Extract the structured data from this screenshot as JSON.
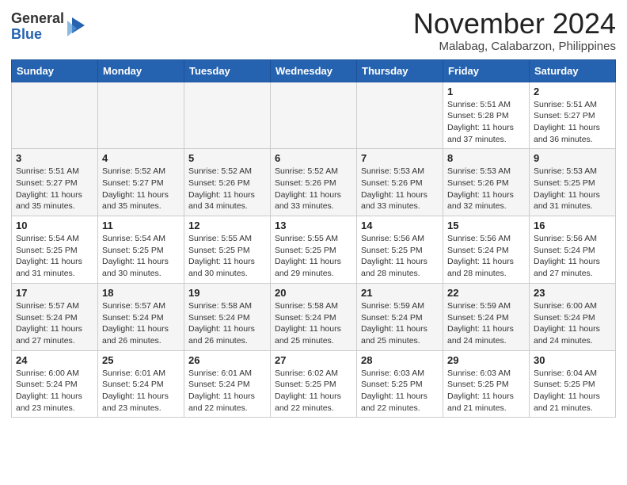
{
  "logo": {
    "general": "General",
    "blue": "Blue"
  },
  "title": "November 2024",
  "location": "Malabag, Calabarzon, Philippines",
  "weekdays": [
    "Sunday",
    "Monday",
    "Tuesday",
    "Wednesday",
    "Thursday",
    "Friday",
    "Saturday"
  ],
  "weeks": [
    [
      {
        "day": "",
        "info": ""
      },
      {
        "day": "",
        "info": ""
      },
      {
        "day": "",
        "info": ""
      },
      {
        "day": "",
        "info": ""
      },
      {
        "day": "",
        "info": ""
      },
      {
        "day": "1",
        "info": "Sunrise: 5:51 AM\nSunset: 5:28 PM\nDaylight: 11 hours\nand 37 minutes."
      },
      {
        "day": "2",
        "info": "Sunrise: 5:51 AM\nSunset: 5:27 PM\nDaylight: 11 hours\nand 36 minutes."
      }
    ],
    [
      {
        "day": "3",
        "info": "Sunrise: 5:51 AM\nSunset: 5:27 PM\nDaylight: 11 hours\nand 35 minutes."
      },
      {
        "day": "4",
        "info": "Sunrise: 5:52 AM\nSunset: 5:27 PM\nDaylight: 11 hours\nand 35 minutes."
      },
      {
        "day": "5",
        "info": "Sunrise: 5:52 AM\nSunset: 5:26 PM\nDaylight: 11 hours\nand 34 minutes."
      },
      {
        "day": "6",
        "info": "Sunrise: 5:52 AM\nSunset: 5:26 PM\nDaylight: 11 hours\nand 33 minutes."
      },
      {
        "day": "7",
        "info": "Sunrise: 5:53 AM\nSunset: 5:26 PM\nDaylight: 11 hours\nand 33 minutes."
      },
      {
        "day": "8",
        "info": "Sunrise: 5:53 AM\nSunset: 5:26 PM\nDaylight: 11 hours\nand 32 minutes."
      },
      {
        "day": "9",
        "info": "Sunrise: 5:53 AM\nSunset: 5:25 PM\nDaylight: 11 hours\nand 31 minutes."
      }
    ],
    [
      {
        "day": "10",
        "info": "Sunrise: 5:54 AM\nSunset: 5:25 PM\nDaylight: 11 hours\nand 31 minutes."
      },
      {
        "day": "11",
        "info": "Sunrise: 5:54 AM\nSunset: 5:25 PM\nDaylight: 11 hours\nand 30 minutes."
      },
      {
        "day": "12",
        "info": "Sunrise: 5:55 AM\nSunset: 5:25 PM\nDaylight: 11 hours\nand 30 minutes."
      },
      {
        "day": "13",
        "info": "Sunrise: 5:55 AM\nSunset: 5:25 PM\nDaylight: 11 hours\nand 29 minutes."
      },
      {
        "day": "14",
        "info": "Sunrise: 5:56 AM\nSunset: 5:25 PM\nDaylight: 11 hours\nand 28 minutes."
      },
      {
        "day": "15",
        "info": "Sunrise: 5:56 AM\nSunset: 5:24 PM\nDaylight: 11 hours\nand 28 minutes."
      },
      {
        "day": "16",
        "info": "Sunrise: 5:56 AM\nSunset: 5:24 PM\nDaylight: 11 hours\nand 27 minutes."
      }
    ],
    [
      {
        "day": "17",
        "info": "Sunrise: 5:57 AM\nSunset: 5:24 PM\nDaylight: 11 hours\nand 27 minutes."
      },
      {
        "day": "18",
        "info": "Sunrise: 5:57 AM\nSunset: 5:24 PM\nDaylight: 11 hours\nand 26 minutes."
      },
      {
        "day": "19",
        "info": "Sunrise: 5:58 AM\nSunset: 5:24 PM\nDaylight: 11 hours\nand 26 minutes."
      },
      {
        "day": "20",
        "info": "Sunrise: 5:58 AM\nSunset: 5:24 PM\nDaylight: 11 hours\nand 25 minutes."
      },
      {
        "day": "21",
        "info": "Sunrise: 5:59 AM\nSunset: 5:24 PM\nDaylight: 11 hours\nand 25 minutes."
      },
      {
        "day": "22",
        "info": "Sunrise: 5:59 AM\nSunset: 5:24 PM\nDaylight: 11 hours\nand 24 minutes."
      },
      {
        "day": "23",
        "info": "Sunrise: 6:00 AM\nSunset: 5:24 PM\nDaylight: 11 hours\nand 24 minutes."
      }
    ],
    [
      {
        "day": "24",
        "info": "Sunrise: 6:00 AM\nSunset: 5:24 PM\nDaylight: 11 hours\nand 23 minutes."
      },
      {
        "day": "25",
        "info": "Sunrise: 6:01 AM\nSunset: 5:24 PM\nDaylight: 11 hours\nand 23 minutes."
      },
      {
        "day": "26",
        "info": "Sunrise: 6:01 AM\nSunset: 5:24 PM\nDaylight: 11 hours\nand 22 minutes."
      },
      {
        "day": "27",
        "info": "Sunrise: 6:02 AM\nSunset: 5:25 PM\nDaylight: 11 hours\nand 22 minutes."
      },
      {
        "day": "28",
        "info": "Sunrise: 6:03 AM\nSunset: 5:25 PM\nDaylight: 11 hours\nand 22 minutes."
      },
      {
        "day": "29",
        "info": "Sunrise: 6:03 AM\nSunset: 5:25 PM\nDaylight: 11 hours\nand 21 minutes."
      },
      {
        "day": "30",
        "info": "Sunrise: 6:04 AM\nSunset: 5:25 PM\nDaylight: 11 hours\nand 21 minutes."
      }
    ]
  ]
}
